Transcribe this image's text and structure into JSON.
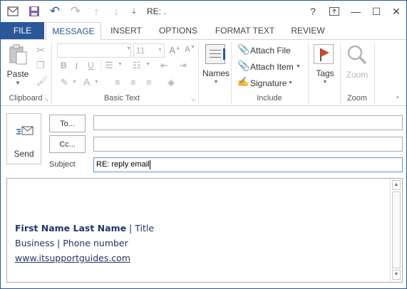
{
  "window": {
    "title": "RE: .",
    "help": "?",
    "restore": "⧉",
    "minimize": "—",
    "maximize": "☐",
    "close": "✕"
  },
  "tabs": [
    "FILE",
    "MESSAGE",
    "INSERT",
    "OPTIONS",
    "FORMAT TEXT",
    "REVIEW"
  ],
  "ribbon": {
    "clipboard": {
      "paste_label": "Paste",
      "group_label": "Clipboard"
    },
    "basic_text": {
      "font_size": "11",
      "group_label": "Basic Text"
    },
    "names": {
      "label": "Names"
    },
    "include": {
      "attach_file": "Attach File",
      "attach_item": "Attach Item",
      "signature": "Signature",
      "group_label": "Include"
    },
    "tags": {
      "label": "Tags"
    },
    "zoom": {
      "button_label": "Zoom",
      "group_label": "Zoom"
    }
  },
  "compose": {
    "send_label": "Send",
    "to_label": "To...",
    "cc_label": "Cc...",
    "subject_label": "Subject",
    "to_value": "",
    "cc_value": "",
    "subject_value": "RE: reply email"
  },
  "signature": {
    "name": "First Name Last Name",
    "separator": " | ",
    "title": "Title",
    "business_line": "Business | Phone number",
    "website": "www.itsupportguides.com"
  },
  "colors": {
    "accent": "#2b579a",
    "signature": "#1f3864",
    "flag": "#d24726"
  },
  "icons": [
    "send-mail-icon",
    "paste-icon",
    "cut-icon",
    "copy-icon",
    "format-painter-icon",
    "address-book-icon",
    "paperclip-icon",
    "signature-icon",
    "flag-icon",
    "magnifier-icon"
  ]
}
